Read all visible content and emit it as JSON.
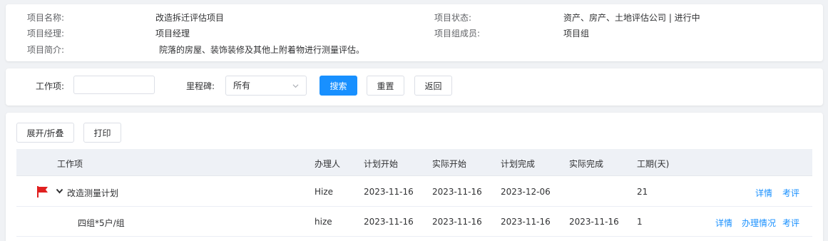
{
  "project": {
    "name_label": "项目名称:",
    "name": "改造拆迁评估项目",
    "manager_label": "项目经理:",
    "manager": "项目经理",
    "desc_label": "项目简介:",
    "desc": "院落的房屋、装饰装修及其他上附着物进行测量评估。",
    "status_label": "项目状态:",
    "status": "资产、房产、土地评估公司 | 进行中",
    "members_label": "项目组成员:",
    "members": "项目组"
  },
  "search": {
    "work_item_label": "工作项:",
    "work_item_value": "",
    "milestone_label": "里程碑:",
    "milestone_value": "所有",
    "search_btn": "搜索",
    "reset_btn": "重置",
    "back_btn": "返回"
  },
  "toolbar": {
    "expand_btn": "展开/折叠",
    "print_btn": "打印"
  },
  "table": {
    "headers": {
      "item": "工作项",
      "assignee": "办理人",
      "plan_start": "计划开始",
      "actual_start": "实际开始",
      "plan_end": "计划完成",
      "actual_end": "实际完成",
      "duration": "工期(天)"
    },
    "rows": [
      {
        "item": "改造测量计划",
        "assignee": "Hize",
        "plan_start": "2023-11-16",
        "actual_start": "2023-11-16",
        "plan_end": "2023-12-06",
        "actual_end": "",
        "duration": "21",
        "action_detail": "详情",
        "action_eval": "考评"
      },
      {
        "item": "四组*5户/组",
        "assignee": "hize",
        "plan_start": "2023-11-16",
        "actual_start": "2023-11-16",
        "plan_end": "2023-11-16",
        "actual_end": "2023-11-16",
        "duration": "1",
        "action_detail": "详情",
        "action_progress": "办理情况",
        "action_eval": "考评"
      }
    ]
  },
  "colors": {
    "primary": "#1890ff",
    "flag": "#e02020",
    "header_bg": "#eef1f6"
  }
}
